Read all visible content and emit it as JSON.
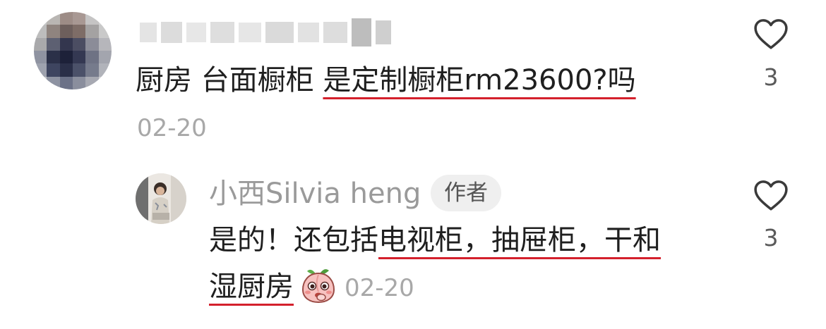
{
  "comment": {
    "text_plain": "厨房 台面橱柜 ",
    "text_highlight": "是定制橱柜rm23600?吗",
    "date": "02-20",
    "like_count": "3"
  },
  "reply": {
    "username": "小西Silvia heng",
    "badge": "作者",
    "line1_plain": "是的！还包括",
    "line1_highlight": "电视柜，抽屉柜，干和",
    "line2_highlight": "湿厨房",
    "emoji": "peach-face-emoji",
    "date": "02-20",
    "like_count": "3"
  },
  "colors": {
    "underline": "#d4202c",
    "date": "#a8a8a8",
    "username": "#9a9a9a",
    "badge_bg": "#efefef"
  }
}
